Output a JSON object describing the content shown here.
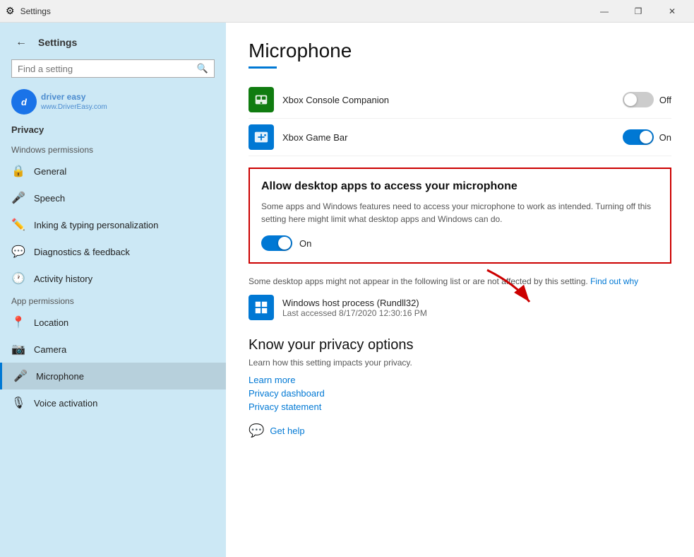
{
  "titlebar": {
    "title": "Settings",
    "min_label": "—",
    "max_label": "❐",
    "close_label": "✕"
  },
  "sidebar": {
    "back_label": "←",
    "title": "Settings",
    "search_placeholder": "Find a setting",
    "watermark_logo": "d",
    "watermark_text": "driver easy\nwww.DriverEasy.com",
    "privacy_heading": "Privacy",
    "windows_permissions": "Windows permissions",
    "app_permissions": "App permissions",
    "nav_items": [
      {
        "id": "general",
        "icon": "🔒",
        "label": "General"
      },
      {
        "id": "speech",
        "icon": "🎙",
        "label": "Speech"
      },
      {
        "id": "inking",
        "icon": "✏️",
        "label": "Inking & typing personalization"
      },
      {
        "id": "diagnostics",
        "icon": "💬",
        "label": "Diagnostics & feedback"
      },
      {
        "id": "activity",
        "icon": "🕐",
        "label": "Activity history"
      },
      {
        "id": "location",
        "icon": "📍",
        "label": "Location"
      },
      {
        "id": "camera",
        "icon": "📷",
        "label": "Camera"
      },
      {
        "id": "microphone",
        "icon": "🎤",
        "label": "Microphone"
      },
      {
        "id": "voice",
        "icon": "🎙",
        "label": "Voice activation"
      }
    ]
  },
  "content": {
    "page_title": "Microphone",
    "apps": [
      {
        "id": "xbox-console",
        "name": "Xbox Console Companion",
        "toggle_state": "off",
        "toggle_text": "Off"
      },
      {
        "id": "xbox-game",
        "name": "Xbox Game Bar",
        "toggle_state": "on",
        "toggle_text": "On"
      }
    ],
    "allow_desktop": {
      "title": "Allow desktop apps to access your microphone",
      "description": "Some apps and Windows features need to access your microphone to work as intended. Turning off this setting here might limit what desktop apps and Windows can do.",
      "toggle_state": "on",
      "toggle_text": "On"
    },
    "info_text": "Some desktop apps might not appear in the following list or are not affected by this setting.",
    "find_out_why": "Find out why",
    "process": {
      "name": "Windows host process (Rundll32)",
      "last_accessed": "Last accessed 8/17/2020 12:30:16 PM"
    },
    "privacy_options": {
      "title": "Know your privacy options",
      "description": "Learn how this setting impacts your privacy.",
      "links": [
        "Learn more",
        "Privacy dashboard",
        "Privacy statement"
      ]
    },
    "get_help": "Get help"
  }
}
